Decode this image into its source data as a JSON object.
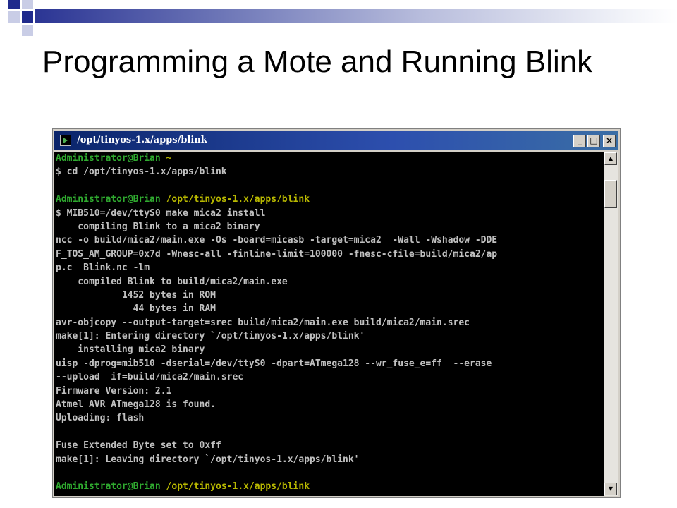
{
  "slide": {
    "title": "Programming a Mote and Running Blink"
  },
  "window": {
    "title": "/opt/tinyos-1.x/apps/blink",
    "controls": {
      "minimize": "_",
      "maximize": "□",
      "close": "×"
    },
    "scroll_position": 0.05
  },
  "colors": {
    "prompt_user": "#2faa2f",
    "prompt_path": "#b8b800",
    "text": "#c0c0c0",
    "background": "#000000"
  },
  "console_lines": [
    {
      "segments": [
        {
          "text": "Administrator@Brian ",
          "style": "green"
        },
        {
          "text": "~",
          "style": "yellow"
        }
      ]
    },
    {
      "segments": [
        {
          "text": "$ cd /opt/tinyos-1.x/apps/blink",
          "style": "normal"
        }
      ]
    },
    {
      "segments": [
        {
          "text": "",
          "style": "normal"
        }
      ]
    },
    {
      "segments": [
        {
          "text": "Administrator@Brian ",
          "style": "green"
        },
        {
          "text": "/opt/tinyos-1.x/apps/blink",
          "style": "yellow"
        }
      ]
    },
    {
      "segments": [
        {
          "text": "$ MIB510=/dev/ttyS0 make mica2 install",
          "style": "normal"
        }
      ]
    },
    {
      "segments": [
        {
          "text": "    compiling Blink to a mica2 binary",
          "style": "normal"
        }
      ]
    },
    {
      "segments": [
        {
          "text": "ncc -o build/mica2/main.exe -Os -board=micasb -target=mica2  -Wall -Wshadow -DDE",
          "style": "normal"
        }
      ]
    },
    {
      "segments": [
        {
          "text": "F_TOS_AM_GROUP=0x7d -Wnesc-all -finline-limit=100000 -fnesc-cfile=build/mica2/ap",
          "style": "normal"
        }
      ]
    },
    {
      "segments": [
        {
          "text": "p.c  Blink.nc -lm",
          "style": "normal"
        }
      ]
    },
    {
      "segments": [
        {
          "text": "    compiled Blink to build/mica2/main.exe",
          "style": "normal"
        }
      ]
    },
    {
      "segments": [
        {
          "text": "            1452 bytes in ROM",
          "style": "normal"
        }
      ]
    },
    {
      "segments": [
        {
          "text": "              44 bytes in RAM",
          "style": "normal"
        }
      ]
    },
    {
      "segments": [
        {
          "text": "avr-objcopy --output-target=srec build/mica2/main.exe build/mica2/main.srec",
          "style": "normal"
        }
      ]
    },
    {
      "segments": [
        {
          "text": "make[1]: Entering directory `/opt/tinyos-1.x/apps/blink'",
          "style": "normal"
        }
      ]
    },
    {
      "segments": [
        {
          "text": "    installing mica2 binary",
          "style": "normal"
        }
      ]
    },
    {
      "segments": [
        {
          "text": "uisp -dprog=mib510 -dserial=/dev/ttyS0 -dpart=ATmega128 --wr_fuse_e=ff  --erase",
          "style": "normal"
        }
      ]
    },
    {
      "segments": [
        {
          "text": "--upload  if=build/mica2/main.srec",
          "style": "normal"
        }
      ]
    },
    {
      "segments": [
        {
          "text": "Firmware Version: 2.1",
          "style": "normal"
        }
      ]
    },
    {
      "segments": [
        {
          "text": "Atmel AVR ATmega128 is found.",
          "style": "normal"
        }
      ]
    },
    {
      "segments": [
        {
          "text": "Uploading: flash",
          "style": "normal"
        }
      ]
    },
    {
      "segments": [
        {
          "text": "",
          "style": "normal"
        }
      ]
    },
    {
      "segments": [
        {
          "text": "Fuse Extended Byte set to 0xff",
          "style": "normal"
        }
      ]
    },
    {
      "segments": [
        {
          "text": "make[1]: Leaving directory `/opt/tinyos-1.x/apps/blink'",
          "style": "normal"
        }
      ]
    },
    {
      "segments": [
        {
          "text": "",
          "style": "normal"
        }
      ]
    },
    {
      "segments": [
        {
          "text": "Administrator@Brian ",
          "style": "green"
        },
        {
          "text": "/opt/tinyos-1.x/apps/blink",
          "style": "yellow"
        }
      ]
    }
  ]
}
